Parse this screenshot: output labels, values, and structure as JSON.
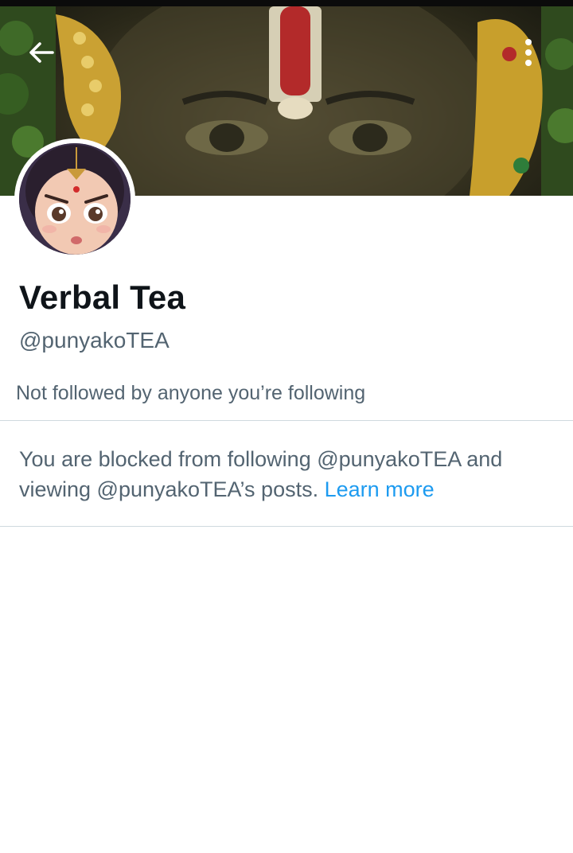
{
  "header": {
    "back_icon": "arrow-left-icon",
    "more_icon": "more-vertical-icon"
  },
  "banner": {
    "description_icon": "banner-image"
  },
  "profile": {
    "display_name": "Verbal Tea",
    "handle": "@punyakoTEA",
    "followers_note": "Not followed by anyone you’re following"
  },
  "blocked": {
    "message": "You are blocked from following @punyakoTEA and viewing @punyakoTEA’s posts.",
    "learn_more": "Learn more"
  },
  "colors": {
    "text_primary": "#0f1419",
    "text_secondary": "#536471",
    "link": "#1d9bf0",
    "divider": "#cfd9de"
  }
}
